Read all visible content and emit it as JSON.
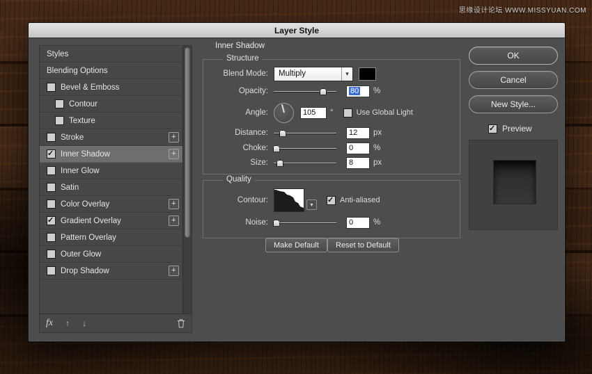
{
  "watermark": "思缘设计论坛 WWW.MISSYUAN.COM",
  "dialog": {
    "title": "Layer Style"
  },
  "colors": {
    "selection": "#3a6cd4",
    "blend_color_swatch": "#000000"
  },
  "icons": {
    "combo_arrow": "▾",
    "contour_arrow": "▾",
    "up_arrow": "↑",
    "down_arrow": "↓",
    "fx": "fx",
    "plus": "+"
  },
  "sidebar": {
    "items": [
      {
        "label": "Styles",
        "checkbox": false
      },
      {
        "label": "Blending Options",
        "checkbox": false
      },
      {
        "label": "Bevel & Emboss",
        "checkbox": true,
        "checked": false
      },
      {
        "label": "Contour",
        "checkbox": true,
        "checked": false,
        "indent": true
      },
      {
        "label": "Texture",
        "checkbox": true,
        "checked": false,
        "indent": true
      },
      {
        "label": "Stroke",
        "checkbox": true,
        "checked": false,
        "plus": true
      },
      {
        "label": "Inner Shadow",
        "checkbox": true,
        "checked": true,
        "plus": true,
        "selected": true
      },
      {
        "label": "Inner Glow",
        "checkbox": true,
        "checked": false
      },
      {
        "label": "Satin",
        "checkbox": true,
        "checked": false
      },
      {
        "label": "Color Overlay",
        "checkbox": true,
        "checked": false,
        "plus": true
      },
      {
        "label": "Gradient Overlay",
        "checkbox": true,
        "checked": true,
        "plus": true
      },
      {
        "label": "Pattern Overlay",
        "checkbox": true,
        "checked": false
      },
      {
        "label": "Outer Glow",
        "checkbox": true,
        "checked": false
      },
      {
        "label": "Drop Shadow",
        "checkbox": true,
        "checked": false,
        "plus": true
      }
    ]
  },
  "panel": {
    "heading": "Inner Shadow",
    "structure": {
      "legend": "Structure",
      "blend_mode": {
        "label": "Blend Mode:",
        "value": "Multiply"
      },
      "opacity": {
        "label": "Opacity:",
        "value": "80",
        "unit": "%",
        "slider_pct": 79
      },
      "angle": {
        "label": "Angle:",
        "value": "105",
        "unit": "°",
        "global_light_label": "Use Global Light",
        "global_light_checked": false
      },
      "distance": {
        "label": "Distance:",
        "value": "12",
        "unit": "px",
        "slider_pct": 14
      },
      "choke": {
        "label": "Choke:",
        "value": "0",
        "unit": "%",
        "slider_pct": 4
      },
      "size": {
        "label": "Size:",
        "value": "8",
        "unit": "px",
        "slider_pct": 10
      }
    },
    "quality": {
      "legend": "Quality",
      "contour": {
        "label": "Contour:",
        "anti_aliased_label": "Anti-aliased",
        "anti_aliased_checked": true
      },
      "noise": {
        "label": "Noise:",
        "value": "0",
        "unit": "%",
        "slider_pct": 4
      }
    },
    "default_buttons": {
      "make_default": "Make Default",
      "reset_default": "Reset to Default"
    }
  },
  "actions": {
    "ok": "OK",
    "cancel": "Cancel",
    "new_style": "New Style...",
    "preview_label": "Preview",
    "preview_checked": true
  }
}
